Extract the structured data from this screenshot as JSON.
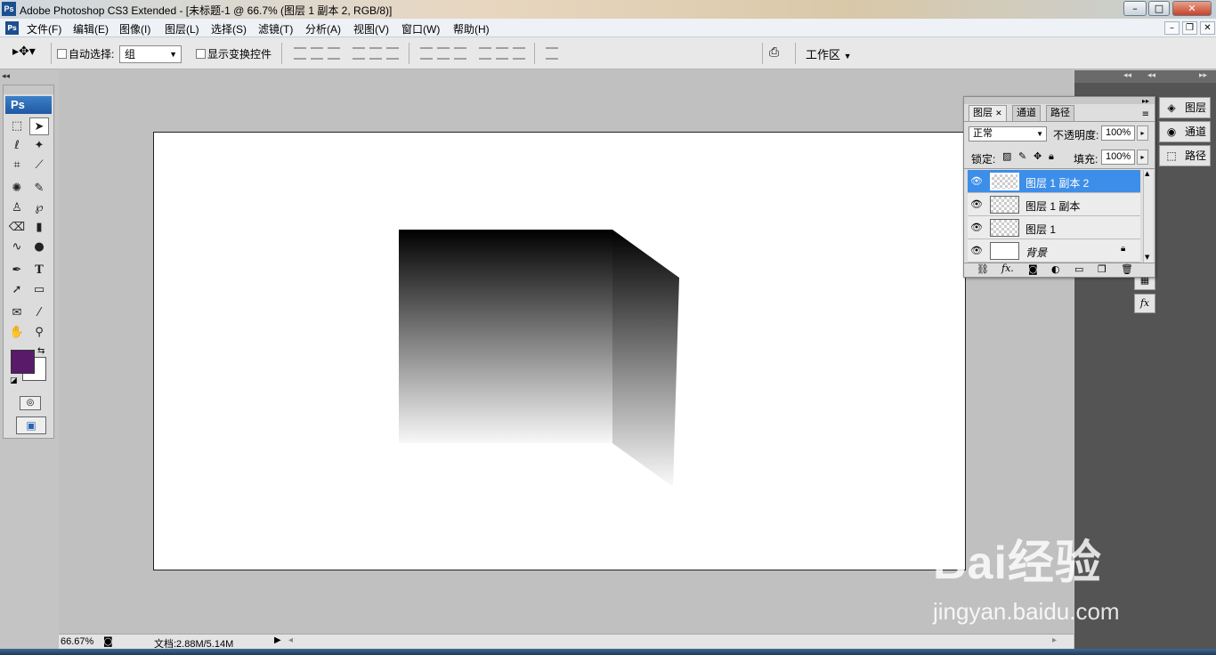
{
  "window": {
    "title": "Adobe Photoshop CS3 Extended - [未标题-1 @ 66.7% (图层 1 副本 2, RGB/8)]"
  },
  "menu": [
    "文件(F)",
    "编辑(E)",
    "图像(I)",
    "图层(L)",
    "选择(S)",
    "滤镜(T)",
    "分析(A)",
    "视图(V)",
    "窗口(W)",
    "帮助(H)"
  ],
  "options": {
    "auto_select_label": "自动选择:",
    "auto_select_value": "组",
    "show_transform_label": "显示变换控件",
    "workspace_label": "工作区"
  },
  "toolbox": {
    "logo": "Ps",
    "foreground_color": "#5a1a6a",
    "background_color": "#ffffff"
  },
  "status": {
    "zoom": "66.67%",
    "doc_info": "文档:2.88M/5.14M"
  },
  "layers_panel": {
    "tabs": [
      "图层",
      "通道",
      "路径"
    ],
    "blend_mode": "正常",
    "opacity_label": "不透明度:",
    "opacity_value": "100%",
    "lock_label": "锁定:",
    "fill_label": "填充:",
    "fill_value": "100%",
    "layers": [
      {
        "name": "图层 1 副本 2",
        "selected": true
      },
      {
        "name": "图层 1 副本",
        "selected": false
      },
      {
        "name": "图层 1",
        "selected": false
      },
      {
        "name": "背景",
        "selected": false
      }
    ]
  },
  "side_panels": [
    "图层",
    "通道",
    "路径"
  ],
  "watermark": {
    "brand": "Bai经验",
    "url": "jingyan.baidu.com"
  }
}
